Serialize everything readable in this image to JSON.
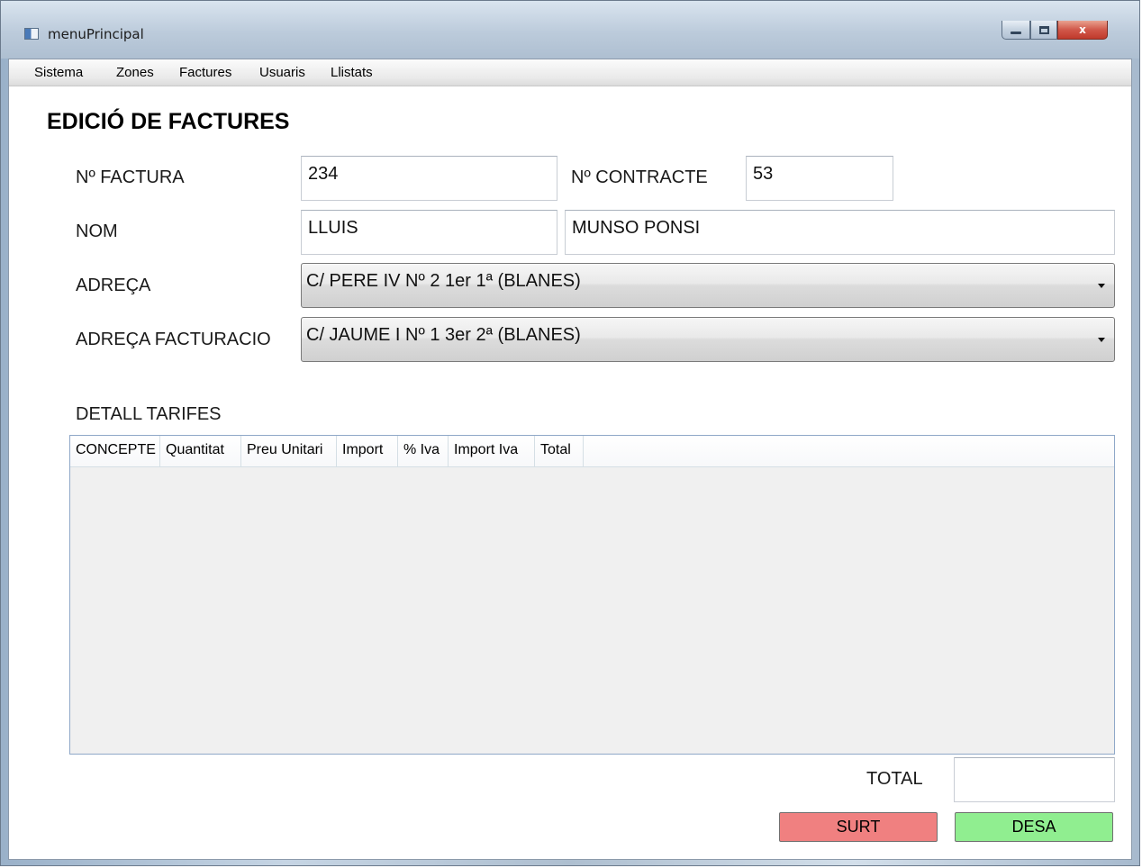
{
  "window": {
    "title": "menuPrincipal",
    "controls": {
      "minimize": "",
      "maximize": "",
      "close": "x"
    }
  },
  "menu": [
    "Sistema",
    "Zones",
    "Factures",
    "Usuaris",
    "Llistats"
  ],
  "heading": "EDICIÓ DE FACTURES",
  "form": {
    "invoice_number": {
      "label": "Nº FACTURA",
      "value": "234"
    },
    "contract_number": {
      "label": "Nº CONTRACTE",
      "value": "53"
    },
    "name": {
      "label": "NOM",
      "first_name": "LLUIS",
      "last_name": "MUNSO PONSI"
    },
    "address": {
      "label": "ADREÇA",
      "selected": "C/ PERE IV Nº 2 1er 1ª (BLANES)"
    },
    "billing_address": {
      "label": "ADREÇA FACTURACIO",
      "selected": "C/ JAUME I Nº 1 3er 2ª (BLANES)"
    }
  },
  "tariffs": {
    "label": "DETALL TARIFES",
    "columns": [
      "CONCEPTE",
      "Quantitat",
      "Preu Unitari",
      "Import",
      "% Iva",
      "Import Iva",
      "Total"
    ],
    "rows": []
  },
  "total": {
    "label": "TOTAL",
    "value": ""
  },
  "buttons": {
    "exit": "SURT",
    "save": "DESA"
  },
  "colors": {
    "exit_button": "#f08080",
    "save_button": "#90ee90",
    "grid_border": "#8fa8c8"
  }
}
